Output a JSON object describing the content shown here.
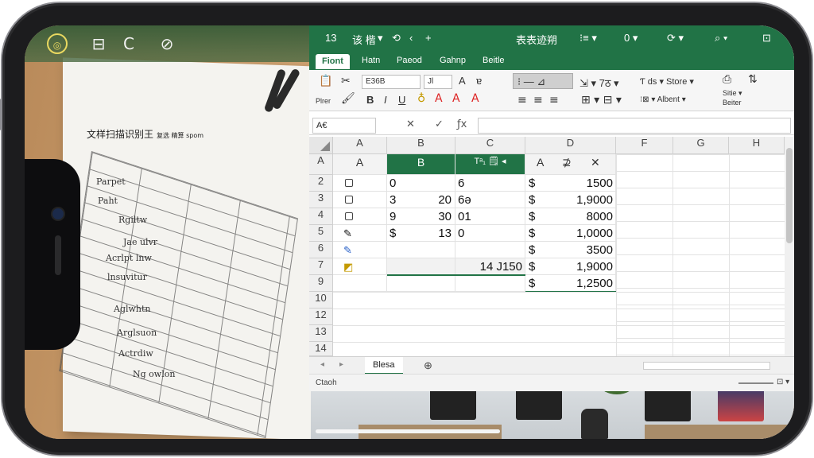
{
  "camera_toolbar": {
    "icons": [
      "circle-ring-icon",
      "split-view-icon",
      "rotate-icon",
      "search-icon"
    ],
    "ring_glyph": "◎",
    "split_glyph": "⊟",
    "rotate_glyph": "C",
    "search_glyph": "⊘"
  },
  "paper": {
    "title": "文样扫描识别王",
    "title_small": "复选 精算 spom",
    "labels": [
      "Parpet",
      "Paht",
      "Rgiltw",
      "Jae ulvr",
      "Acrlpt lnw",
      "lnsuvitur",
      "Aglwhtn",
      "Arglsuon",
      "Actrdiw",
      "Ng owlon"
    ]
  },
  "app": {
    "titlebar": {
      "left_num": "13",
      "title_text": "表表迹朔",
      "items": [
        "该 楷",
        "▾",
        "⟲",
        "‹",
        "+"
      ],
      "right_items": [
        "⁝≡ ▾",
        "0 ▾",
        "⟳ ▾",
        "⌕ ▾",
        "⊡"
      ]
    },
    "tabs": [
      "Fiont",
      "Hatn",
      "Paeod",
      "Gahnp",
      "Beitle"
    ],
    "ribbon": {
      "font_name": "E36B",
      "font_size": "Jl",
      "grow": "A",
      "bold": "B",
      "italic": "I",
      "underline": "U",
      "paste_label": "Plrer",
      "align_label": "⁝ — ⊿",
      "wrap_label": "⇲ ▾ 7ठ ▾",
      "right_text_1": "Ƭ ds ▾ Store ▾",
      "right_text_2": "⁝⊠ ▾ Albent ▾",
      "right_text_3": "Sitie ▾",
      "right_text_4": "Beiter"
    },
    "formula_bar": {
      "name_box": "A€",
      "cancel": "✕",
      "enter": "✓",
      "fx": "ƒx",
      "value": ""
    },
    "columns": [
      "A",
      "B",
      "C",
      "D",
      "F",
      "G",
      "H"
    ],
    "row_numbers": [
      "2",
      "3",
      "4",
      "5",
      "6",
      "7",
      "9",
      "10",
      "12",
      "13",
      "14"
    ],
    "header_row": {
      "a": "A",
      "b": "B",
      "c": "Tᵃ₁ 🗒 ◂",
      "d_left": "A",
      "d_mid": "⊉",
      "d_right": "✕"
    },
    "rows": [
      {
        "b": "0",
        "c": "6",
        "cur": "$",
        "d": "1500"
      },
      {
        "b": "3",
        "b2": "20",
        "c": "6ǝ",
        "cur": "$",
        "d": "1,9000"
      },
      {
        "b": "9",
        "b2": "30",
        "c": "01",
        "cur": "$",
        "d": "8000"
      },
      {
        "b": "$",
        "b2": "13",
        "c": "0",
        "cur": "$",
        "d": "1,0000"
      },
      {
        "b": "",
        "b2": "",
        "c": "",
        "cur": "$",
        "d": "3500"
      },
      {
        "b": "",
        "b2": "",
        "c": "14 J150",
        "cur": "$",
        "d": "1,9000"
      },
      {
        "b": "",
        "b2": "",
        "c": "",
        "cur": "$",
        "d": "1,2500"
      }
    ],
    "sheet_tab": "Blesa",
    "add_sheet": "⊕",
    "status_left": "Ctaoh",
    "status_right": "⊡ ▾"
  }
}
